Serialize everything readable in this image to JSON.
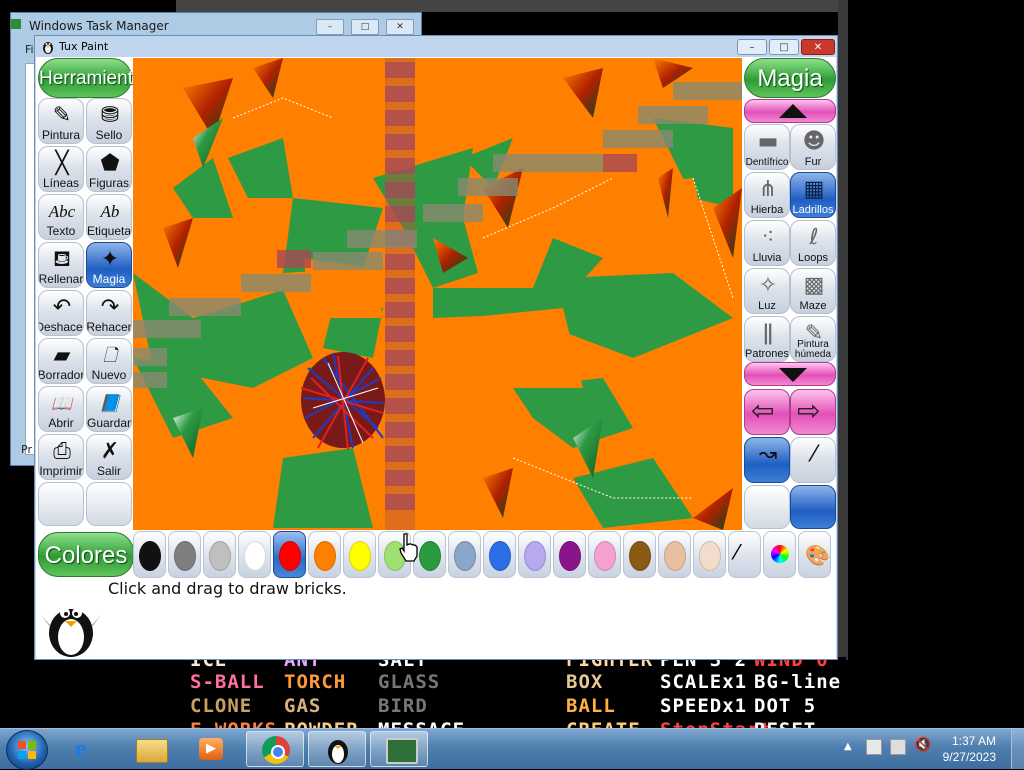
{
  "background_windows": {
    "task_manager_title": "Windows Task Manager",
    "task_manager_menu_fragment": "Fi",
    "task_manager_status_fragment": "Pr"
  },
  "game_text": {
    "row0": [
      {
        "text": "ICE",
        "color": "#f4ead0"
      },
      {
        "text": "ANT",
        "color": "#e6a8ff"
      },
      {
        "text": "SALT",
        "color": "#ffffff"
      },
      {
        "text": "FIGHTER",
        "color": "#ffd8a8"
      },
      {
        "text": "PEN 3 2",
        "color": "#ffffff"
      },
      {
        "text": "WIND 0",
        "color": "#ff4040"
      }
    ],
    "row1": [
      {
        "text": "S-BALL",
        "color": "#ff6fa0"
      },
      {
        "text": "TORCH",
        "color": "#ff9a3a"
      },
      {
        "text": "GLASS",
        "color": "#777777"
      },
      {
        "text": "BOX",
        "color": "#e8c890"
      },
      {
        "text": "SCALEx1",
        "color": "#ffffff"
      },
      {
        "text": "BG-line",
        "color": "#ffffff"
      }
    ],
    "row2": [
      {
        "text": "CLONE",
        "color": "#c8a060"
      },
      {
        "text": "GAS",
        "color": "#d8b080"
      },
      {
        "text": "BIRD",
        "color": "#777777"
      },
      {
        "text": "BALL",
        "color": "#ffb040"
      },
      {
        "text": "SPEEDx1",
        "color": "#ffffff"
      },
      {
        "text": "DOT 5",
        "color": "#ffffff"
      }
    ],
    "row3": [
      {
        "text": "F-WORKS",
        "color": "#ff8040"
      },
      {
        "text": "POWDER",
        "color": "#ffcc88"
      },
      {
        "text": "MESSAGE",
        "color": "#ffffff"
      },
      {
        "text": "CREATE",
        "color": "#ffd070"
      },
      {
        "text": "StopStart",
        "color": "#ff4040"
      },
      {
        "text": "RESET",
        "color": "#ffffff"
      }
    ]
  },
  "window": {
    "title": "Tux Paint",
    "minimize": "–",
    "maximize": "□",
    "close": "✕"
  },
  "left_panel": {
    "header": "Herramientas",
    "tools": [
      {
        "label": "Pintura",
        "icon": "paintbrush-icon",
        "glyph": "✎"
      },
      {
        "label": "Sello",
        "icon": "stamp-icon",
        "glyph": "⛃"
      },
      {
        "label": "Líneas",
        "icon": "lines-icon",
        "glyph": "╳"
      },
      {
        "label": "Figuras",
        "icon": "pentagon-icon",
        "glyph": "⬟"
      },
      {
        "label": "Texto",
        "icon": "text-icon",
        "glyph": "Abc"
      },
      {
        "label": "Etiqueta",
        "icon": "label-icon",
        "glyph": "Ab"
      },
      {
        "label": "Rellenar",
        "icon": "paint-bucket-icon",
        "glyph": "⛾"
      },
      {
        "label": "Magia",
        "icon": "magic-wand-icon",
        "glyph": "✦"
      },
      {
        "label": "Deshacer",
        "icon": "undo-icon",
        "glyph": "↶"
      },
      {
        "label": "Rehacer",
        "icon": "redo-icon",
        "glyph": "↷"
      },
      {
        "label": "Borrador",
        "icon": "eraser-icon",
        "glyph": "▰"
      },
      {
        "label": "Nuevo",
        "icon": "new-document-icon",
        "glyph": "🗋"
      },
      {
        "label": "Abrir",
        "icon": "open-book-icon",
        "glyph": "📖"
      },
      {
        "label": "Guardar",
        "icon": "save-book-icon",
        "glyph": "📘"
      },
      {
        "label": "Imprimir",
        "icon": "printer-icon",
        "glyph": "⎙"
      },
      {
        "label": "Salir",
        "icon": "exit-icon",
        "glyph": "✗"
      }
    ],
    "selected_index": 7
  },
  "right_panel": {
    "header": "Magia",
    "tools": [
      {
        "label": "Dentífrico",
        "icon": "toothpaste-icon",
        "glyph": "▬"
      },
      {
        "label": "Fur",
        "icon": "fur-icon",
        "glyph": "☻"
      },
      {
        "label": "Hierba",
        "icon": "grass-icon",
        "glyph": "⋔"
      },
      {
        "label": "Ladrillos",
        "icon": "bricks-icon",
        "glyph": "▦"
      },
      {
        "label": "Lluvia",
        "icon": "rain-icon",
        "glyph": "⁖"
      },
      {
        "label": "Loops",
        "icon": "loops-icon",
        "glyph": "ℓ"
      },
      {
        "label": "Luz",
        "icon": "light-icon",
        "glyph": "✧"
      },
      {
        "label": "Maze",
        "icon": "maze-icon",
        "glyph": "▩"
      },
      {
        "label": "Patrones",
        "icon": "patterns-icon",
        "glyph": "ǁ"
      },
      {
        "label": "Pintura húmeda",
        "icon": "wet-paint-icon",
        "glyph": "✎"
      }
    ],
    "selected_index": 3
  },
  "colors": {
    "header": "Colores",
    "palette": [
      {
        "name": "black",
        "hex": "#111111"
      },
      {
        "name": "gray",
        "hex": "#7f7f7f"
      },
      {
        "name": "silver",
        "hex": "#bfbfbf"
      },
      {
        "name": "white",
        "hex": "#ffffff"
      },
      {
        "name": "red",
        "hex": "#ff0000"
      },
      {
        "name": "orange",
        "hex": "#ff8000"
      },
      {
        "name": "yellow",
        "hex": "#ffff00"
      },
      {
        "name": "light-green",
        "hex": "#a0e070"
      },
      {
        "name": "green",
        "hex": "#2a9a40"
      },
      {
        "name": "steel-blue",
        "hex": "#8aa6c8"
      },
      {
        "name": "blue",
        "hex": "#2c6ee8"
      },
      {
        "name": "lavender",
        "hex": "#b8a8f0"
      },
      {
        "name": "purple",
        "hex": "#8a148a"
      },
      {
        "name": "pink",
        "hex": "#f6a0d0"
      },
      {
        "name": "brown",
        "hex": "#8a5a14"
      },
      {
        "name": "tan",
        "hex": "#e8c0a0"
      },
      {
        "name": "beige",
        "hex": "#f3dccc"
      }
    ],
    "selected": "red"
  },
  "status_message": "Click and drag to draw bricks.",
  "taskbar": {
    "clock_time": "1:37 AM",
    "clock_date": "9/27/2023"
  }
}
